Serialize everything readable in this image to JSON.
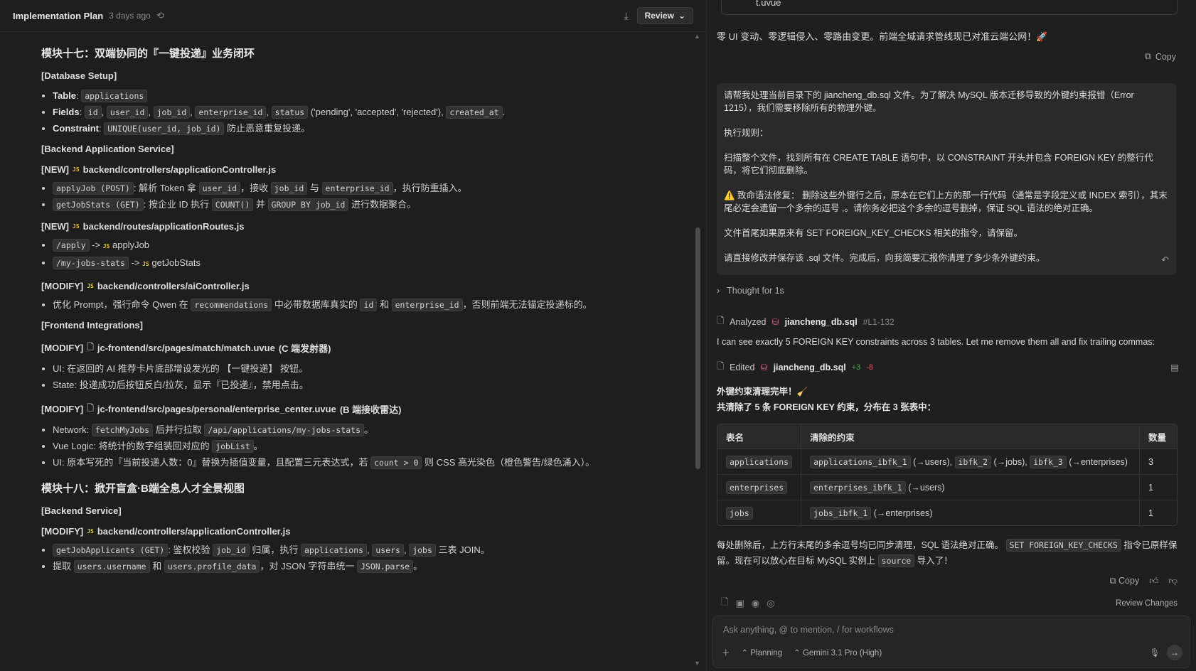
{
  "left_header": {
    "title": "Implementation Plan",
    "age": "3 days ago",
    "review_label": "Review"
  },
  "doc": {
    "h17": "模块十七：双端协同的『一键投递』业务闭环",
    "sec_db": "[Database Setup]",
    "db_table_label": "Table",
    "db_table_value": "applications",
    "db_fields_label": "Fields",
    "db_fields": [
      "id",
      "user_id",
      "job_id",
      "enterprise_id",
      "status"
    ],
    "db_status_values": "('pending', 'accepted', 'rejected'),",
    "db_created_at": "created_at",
    "db_constraint_label": "Constraint",
    "db_constraint_code": "UNIQUE(user_id, job_id)",
    "db_constraint_text": "防止恶意重复投递。",
    "sec_backend_app": "[Backend Application Service]",
    "f1_tag": "[NEW]",
    "f1_path": "backend/controllers/applicationController.js",
    "f1_li1_code": "applyJob (POST)",
    "f1_li1_t1": ": 解析 Token 拿",
    "f1_li1_c2": "user_id",
    "f1_li1_t2": "，接收",
    "f1_li1_c3": "job_id",
    "f1_li1_t3": "与",
    "f1_li1_c4": "enterprise_id",
    "f1_li1_t4": "，执行防重插入。",
    "f1_li2_code": "getJobStats (GET)",
    "f1_li2_t1": ": 按企业 ID 执行",
    "f1_li2_c2": "COUNT()",
    "f1_li2_t2": "并",
    "f1_li2_c3": "GROUP BY job_id",
    "f1_li2_t3": "进行数据聚合。",
    "f2_tag": "[NEW]",
    "f2_path": "backend/routes/applicationRoutes.js",
    "f2_li1_code": "/apply",
    "f2_li1_fn": "applyJob",
    "f2_li2_code": "/my-jobs-stats",
    "f2_li2_fn": "getJobStats",
    "arrow": "->",
    "js_badge": "JS",
    "f3_tag": "[MODIFY]",
    "f3_path": "backend/controllers/aiController.js",
    "f3_li1_t1": "优化 Prompt，强行命令 Qwen 在",
    "f3_li1_c1": "recommendations",
    "f3_li1_t2": "中必带数据库真实的",
    "f3_li1_c2": "id",
    "f3_li1_t3": "和",
    "f3_li1_c3": "enterprise_id",
    "f3_li1_t4": "，否则前端无法锚定投递标的。",
    "sec_frontend": "[Frontend Integrations]",
    "f4_tag": "[MODIFY]",
    "f4_path": "jc-frontend/src/pages/match/match.uvue",
    "f4_note": "(C 端发射器)",
    "f4_li1_label": "UI",
    "f4_li1_text": ": 在返回的 AI 推荐卡片底部增设发光的 【一键投递】 按钮。",
    "f4_li2_label": "State",
    "f4_li2_text": ": 投递成功后按钮反白/拉灰，显示『已投递』，禁用点击。",
    "f5_tag": "[MODIFY]",
    "f5_path": "jc-frontend/src/pages/personal/enterprise_center.uvue",
    "f5_note": "(B 端接收雷达)",
    "f5_li1_label": "Network",
    "f5_li1_c1": "fetchMyJobs",
    "f5_li1_t1": "后并行拉取",
    "f5_li1_c2": "/api/applications/my-jobs-stats",
    "f5_li1_t2": "。",
    "f5_li2_label": "Vue Logic",
    "f5_li2_t1": ": 将统计的数字组装回对应的",
    "f5_li2_c1": "jobList",
    "f5_li2_t2": "。",
    "f5_li3_label": "UI",
    "f5_li3_t1": ": 原本写死的『当前投递人数：0』替换为插值变量，且配置三元表达式，若",
    "f5_li3_c1": "count > 0",
    "f5_li3_t2": "则 CSS 高光染色（橙色警告/绿色涌入）。",
    "h18": "模块十八：掀开盲盒·B端全息人才全景视图",
    "sec_backend": "[Backend Service]",
    "f6_tag": "[MODIFY]",
    "f6_path": "backend/controllers/applicationController.js",
    "f6_li1_code": "getJobApplicants (GET)",
    "f6_li1_t1": ": 鉴权校验",
    "f6_li1_c2": "job_id",
    "f6_li1_t2": "归属，执行",
    "f6_li1_c3": "applications",
    "f6_li1_c4": "users",
    "f6_li1_c5": "jobs",
    "f6_li1_t3": "三表 JOIN。",
    "f6_li2_t1": "提取",
    "f6_li2_c1": "users.username",
    "f6_li2_t2": "和",
    "f6_li2_c2": "users.profile_data",
    "f6_li2_t3": "，对 JSON 字符串统一",
    "f6_li2_c3": "JSON.parse",
    "f6_li2_t4": "。"
  },
  "chat": {
    "top_cell": "t.uvue",
    "intro": "零 UI 变动、零逻辑侵入、零路由变更。前端全域请求管线现已对准云端公网！🚀",
    "copy_label": "Copy",
    "prompt_p1": "请帮我处理当前目录下的 jiancheng_db.sql 文件。为了解决 MySQL 版本迁移导致的外键约束报错（Error 1215），我们需要移除所有的物理外键。",
    "prompt_p2": "执行规则：",
    "prompt_p3": "扫描整个文件，找到所有在 CREATE TABLE 语句中，以 CONSTRAINT 开头并包含 FOREIGN KEY 的整行代码，将它们彻底删除。",
    "prompt_p4": "⚠️ 致命语法修复： 删除这些外键行之后，原本在它们上方的那一行代码（通常是字段定义或 INDEX 索引），其末尾必定会遗留一个多余的逗号 ,。请你务必把这个多余的逗号删掉，保证 SQL 语法的绝对正确。",
    "prompt_p5": "文件首尾如果原来有 SET FOREIGN_KEY_CHECKS 相关的指令，请保留。",
    "prompt_p6": "请直接修改并保存该 .sql 文件。完成后，向我简要汇报你清理了多少条外键约束。",
    "thought": "Thought for 1s",
    "analyzed_label": "Analyzed",
    "analyzed_file": "jiancheng_db.sql",
    "analyzed_lines": "#L1-132",
    "cansee": "I can see exactly 5 FOREIGN KEY constraints across 3 tables. Let me remove them all and fix trailing commas:",
    "edited_label": "Edited",
    "edited_file": "jiancheng_db.sql",
    "edited_plus": "+3",
    "edited_minus": "-8",
    "done_line1": "外键约束清理完毕！🧹",
    "done_line2": "共清除了 5 条 FOREIGN KEY 约束，分布在 3 张表中：",
    "table_headers": [
      "表名",
      "清除的约束",
      "数量"
    ],
    "rows": [
      {
        "table": "applications",
        "c1": "applications_ibfk_1",
        "t1": "(→users),",
        "c2": "ibfk_2",
        "t2": "(→jobs),",
        "c3": "ibfk_3",
        "t3": "(→enterprises)",
        "count": "3"
      },
      {
        "table": "enterprises",
        "c1": "enterprises_ibfk_1",
        "t1": "(→users)",
        "c2": "",
        "t2": "",
        "c3": "",
        "t3": "",
        "count": "1"
      },
      {
        "table": "jobs",
        "c1": "jobs_ibfk_1",
        "t1": "(→enterprises)",
        "c2": "",
        "t2": "",
        "c3": "",
        "t3": "",
        "count": "1"
      }
    ],
    "summary_t1": "每处删除后，上方行末尾的多余逗号均已同步清理，SQL 语法绝对正确。",
    "summary_c1": "SET FOREIGN_KEY_CHECKS",
    "summary_t2": "指令已原样保留。现在可以放心在目标 MySQL 实例上",
    "summary_c2": "source",
    "summary_t3": "导入了！",
    "copy2_label": "Copy",
    "review_changes": "Review Changes",
    "input_placeholder": "Ask anything, @ to mention, / for workflows",
    "mode_label": "Planning",
    "model_label": "Gemini 3.1 Pro (High)"
  }
}
